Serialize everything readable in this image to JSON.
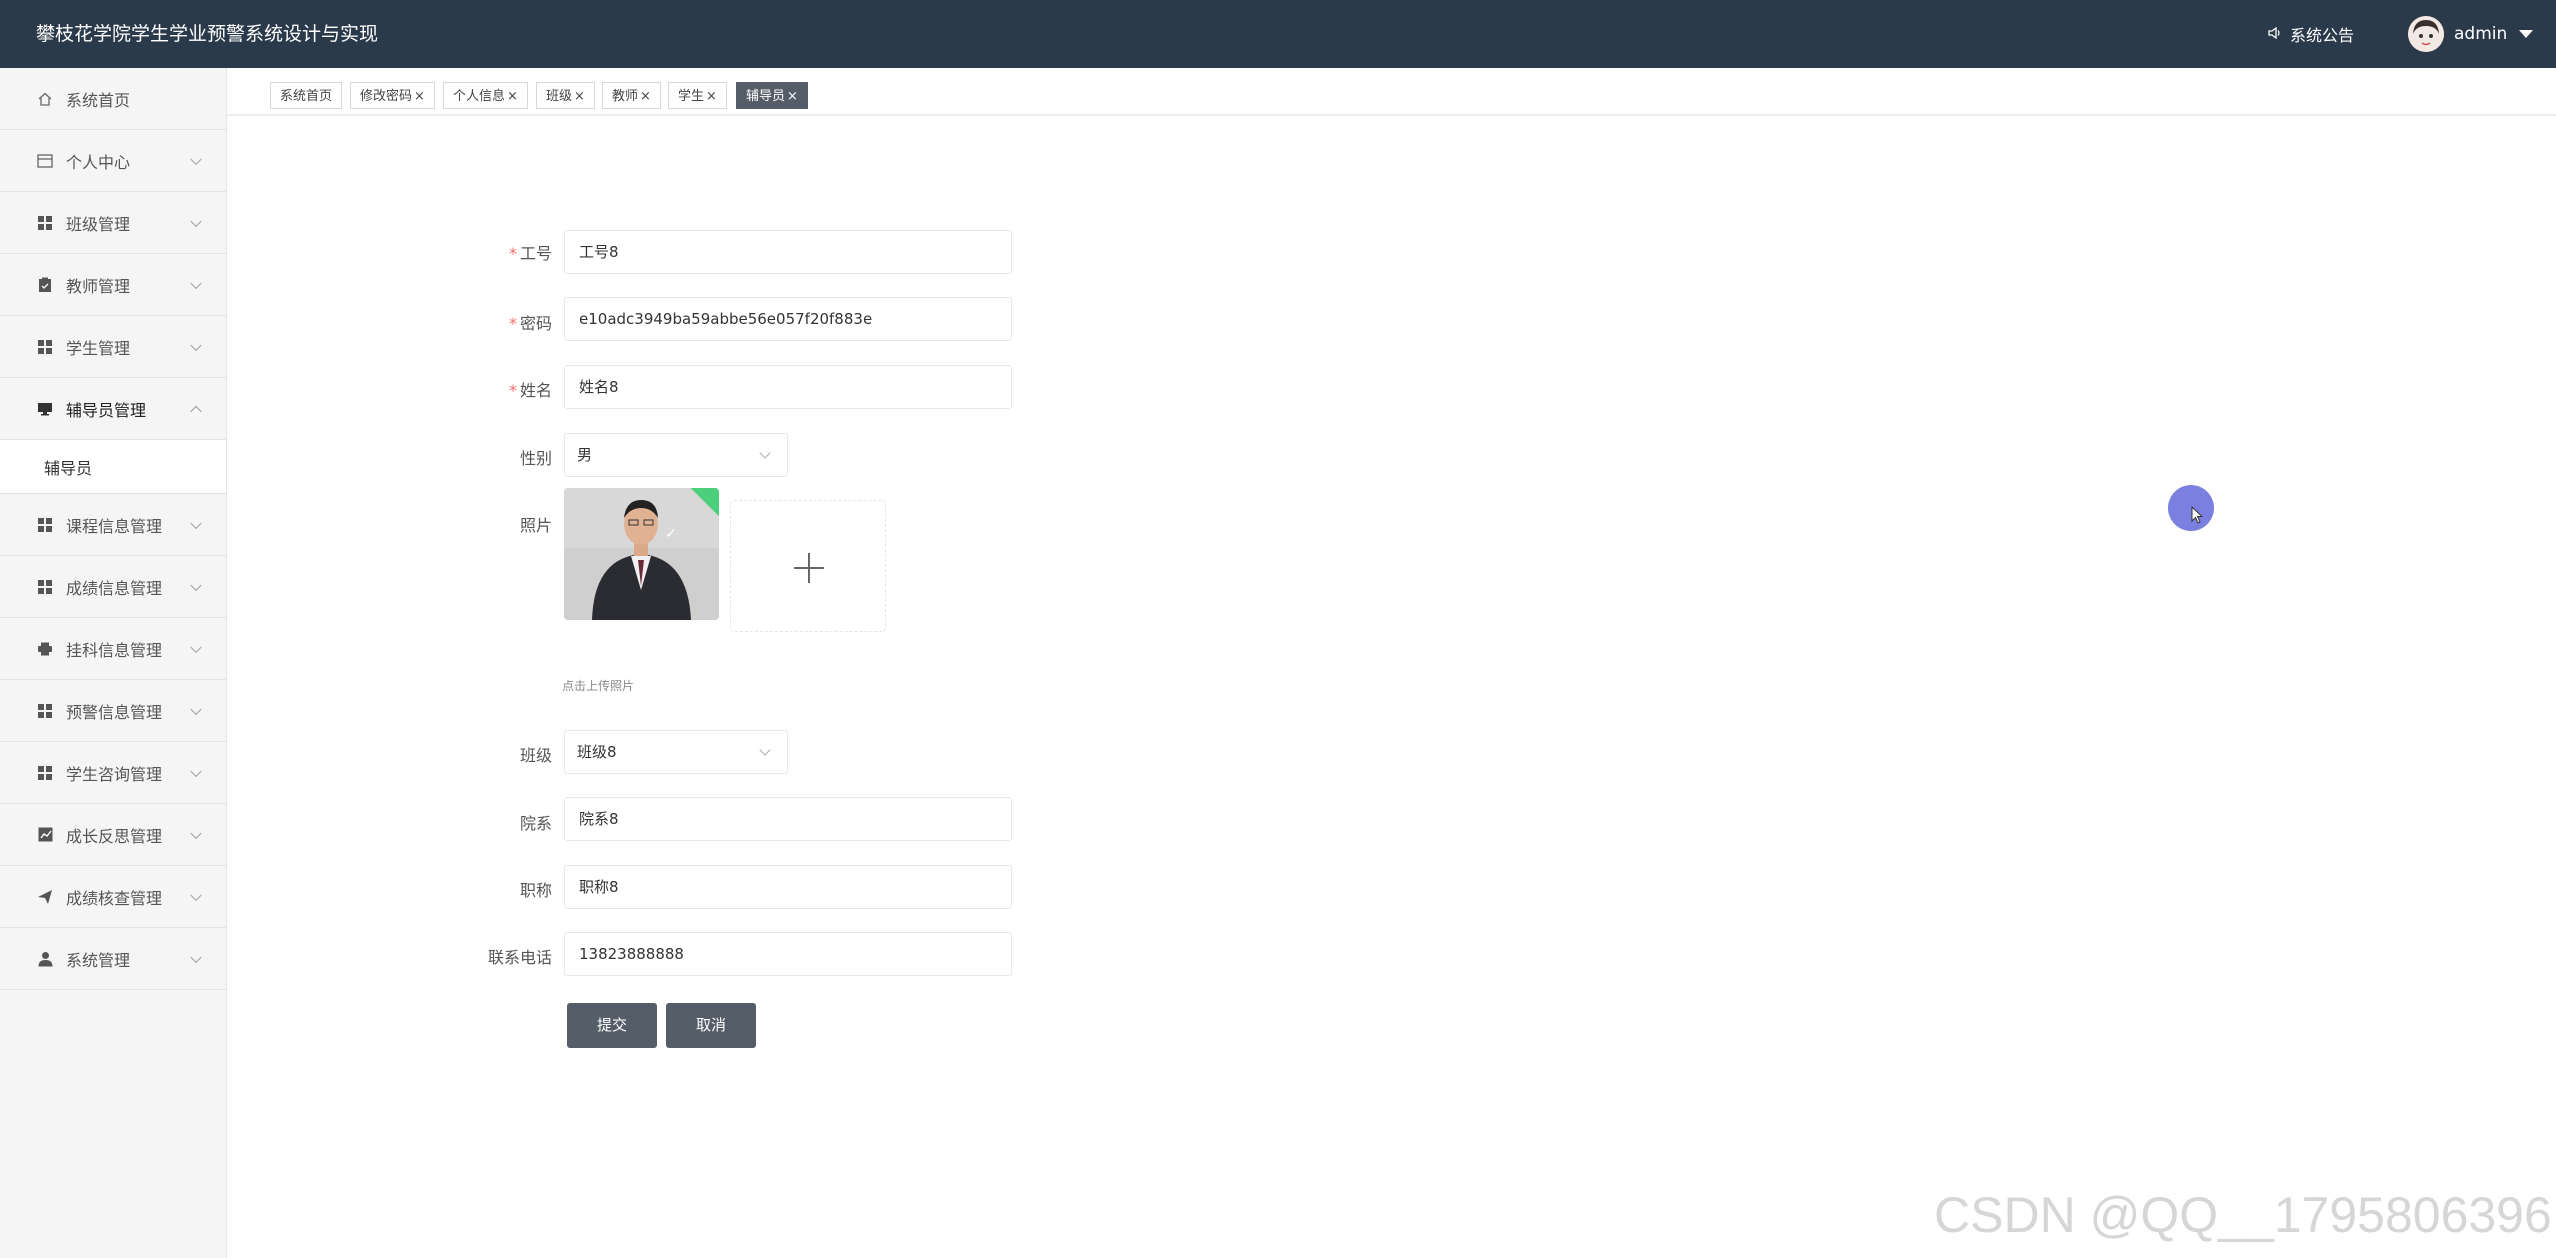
{
  "header": {
    "title": "攀枝花学院学生学业预警系统设计与实现",
    "notice_label": "系统公告",
    "username": "admin"
  },
  "sidebar": {
    "items": [
      {
        "label": "系统首页",
        "icon": "home-icon"
      },
      {
        "label": "个人中心",
        "icon": "window-icon"
      },
      {
        "label": "班级管理",
        "icon": "grid-icon"
      },
      {
        "label": "教师管理",
        "icon": "clipboard-icon"
      },
      {
        "label": "学生管理",
        "icon": "grid-icon"
      },
      {
        "label": "辅导员管理",
        "icon": "monitor-icon",
        "expanded": true,
        "sub": [
          "辅导员"
        ]
      },
      {
        "label": "课程信息管理",
        "icon": "grid-icon"
      },
      {
        "label": "成绩信息管理",
        "icon": "grid-icon"
      },
      {
        "label": "挂科信息管理",
        "icon": "printer-icon"
      },
      {
        "label": "预警信息管理",
        "icon": "grid-icon"
      },
      {
        "label": "学生咨询管理",
        "icon": "grid-icon"
      },
      {
        "label": "成长反思管理",
        "icon": "chart-icon"
      },
      {
        "label": "成绩核查管理",
        "icon": "send-icon"
      },
      {
        "label": "系统管理",
        "icon": "user-icon"
      }
    ]
  },
  "tabs": [
    {
      "label": "系统首页",
      "closable": false
    },
    {
      "label": "修改密码",
      "closable": true
    },
    {
      "label": "个人信息",
      "closable": true
    },
    {
      "label": "班级",
      "closable": true
    },
    {
      "label": "教师",
      "closable": true
    },
    {
      "label": "学生",
      "closable": true
    },
    {
      "label": "辅导员",
      "closable": true,
      "active": true
    }
  ],
  "form": {
    "gonghao": {
      "label": "工号",
      "value": "工号8",
      "required": true
    },
    "mima": {
      "label": "密码",
      "value": "e10adc3949ba59abbe56e057f20f883e",
      "required": true
    },
    "xingming": {
      "label": "姓名",
      "value": "姓名8",
      "required": true
    },
    "xingbie": {
      "label": "性别",
      "value": "男"
    },
    "zhaopian": {
      "label": "照片",
      "hint": "点击上传照片"
    },
    "banji": {
      "label": "班级",
      "value": "班级8"
    },
    "yuanxi": {
      "label": "院系",
      "value": "院系8"
    },
    "zhicheng": {
      "label": "职称",
      "value": "职称8"
    },
    "dianhua": {
      "label": "联系电话",
      "value": "13823888888"
    },
    "submit_label": "提交",
    "cancel_label": "取消"
  },
  "watermark": "CSDN @QQ__1795806396",
  "colors": {
    "header_bg": "#2b3a4a",
    "button_bg": "#555e68",
    "required": "#f56c6c",
    "upload_success": "#4bcf7a"
  }
}
